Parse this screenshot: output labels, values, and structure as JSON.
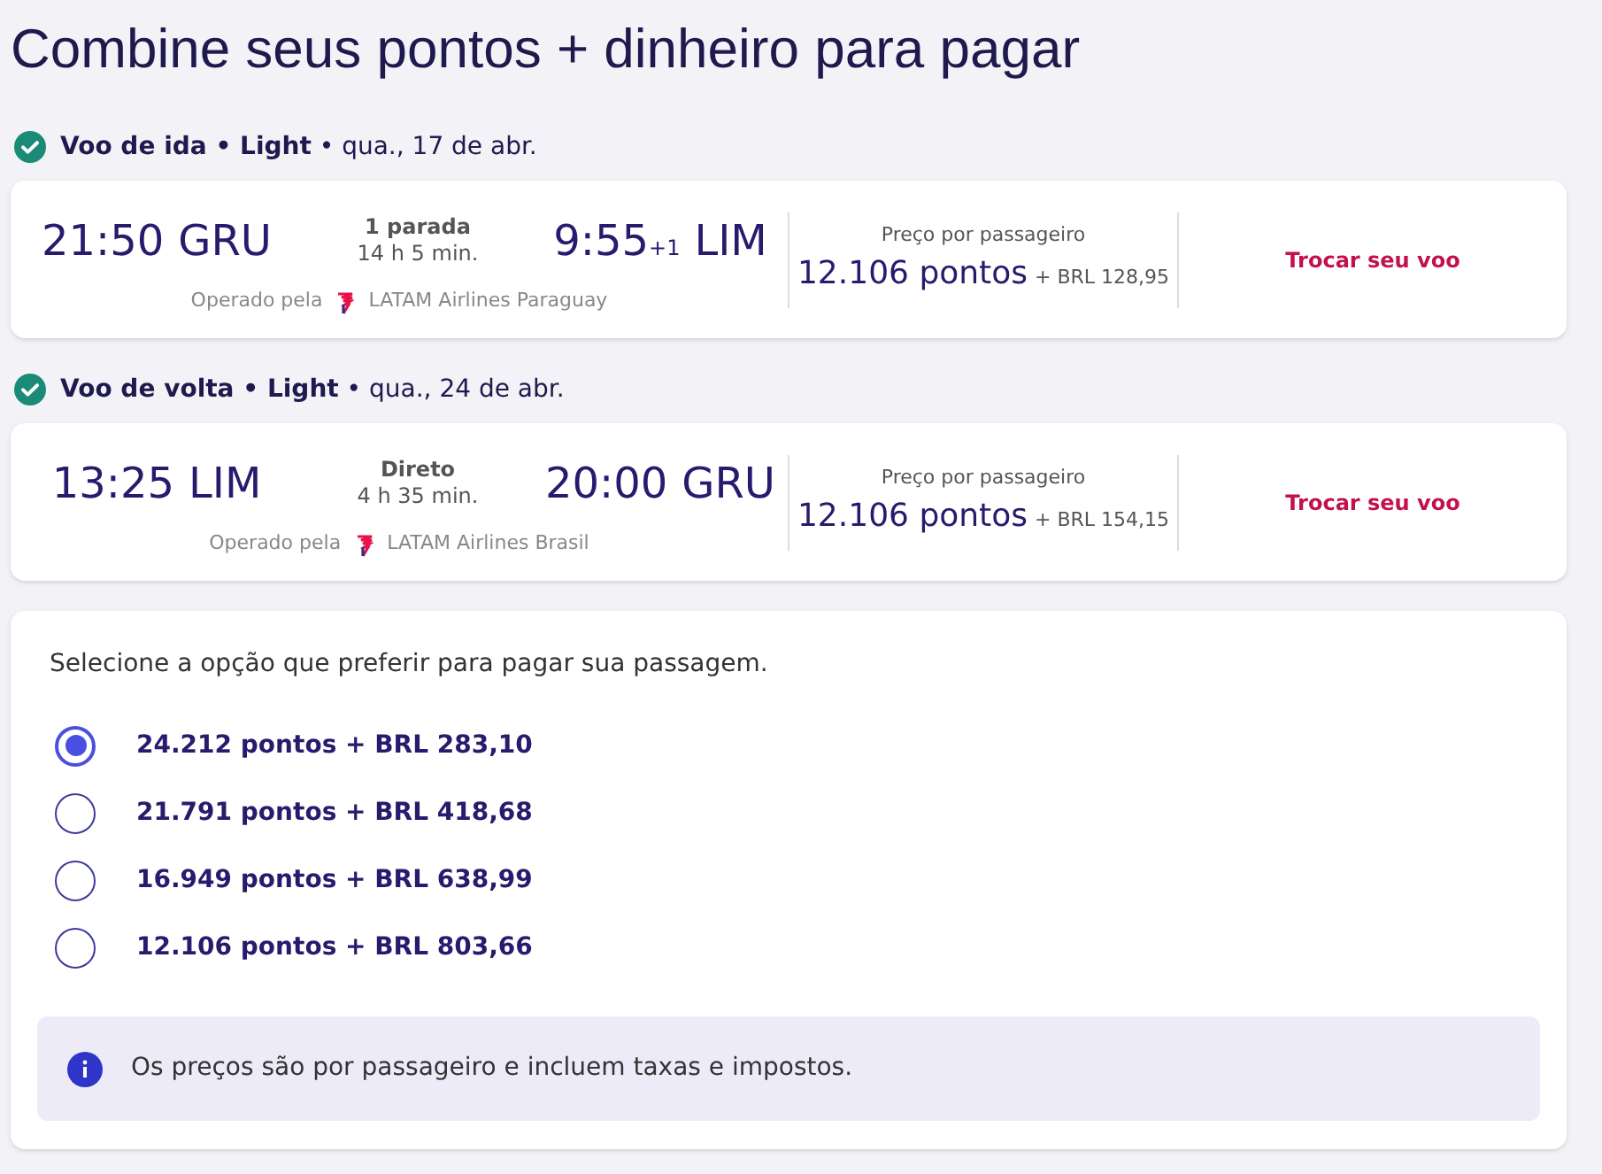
{
  "title": "Combine seus pontos + dinheiro para pagar",
  "legs": [
    {
      "heading": "**Voo de ida • Light** • qua., 17 de abr.",
      "departure": {
        "time": "21:50",
        "airport": "GRU"
      },
      "stops": "1 parada",
      "duration": "14 h 5 min.",
      "arrival": {
        "time": "9:55",
        "day_offset": "+1",
        "airport": "LIM"
      },
      "operated_by": "Operado pela",
      "operator": "LATAM Airlines Paraguay",
      "price_label": "Preço por passageiro",
      "points": "12.106 pontos",
      "cash": "+ BRL 128,95",
      "action": "Trocar seu voo"
    },
    {
      "heading": "**Voo de volta • Light** • qua., 24 de abr.",
      "departure": {
        "time": "13:25",
        "airport": "LIM"
      },
      "stops": "Direto",
      "duration": "4 h 35 min.",
      "arrival": {
        "time": "20:00",
        "airport": "GRU"
      },
      "operated_by": "Operado pela",
      "operator": "LATAM Airlines Brasil",
      "price_label": "Preço por passageiro",
      "points": "12.106 pontos",
      "cash": "+ BRL 154,15",
      "action": "Trocar seu voo"
    }
  ],
  "payment": {
    "prompt": "Selecione a opção que preferir para pagar sua passagem.",
    "options": [
      {
        "label": "24.212 pontos + BRL 283,10",
        "selected": true
      },
      {
        "label": "21.791 pontos + BRL 418,68",
        "selected": false
      },
      {
        "label": "16.949 pontos + BRL 638,99",
        "selected": false
      },
      {
        "label": "12.106 pontos + BRL 803,66",
        "selected": false
      }
    ],
    "note": "Os preços são por passageiro e incluem taxas e impostos."
  }
}
